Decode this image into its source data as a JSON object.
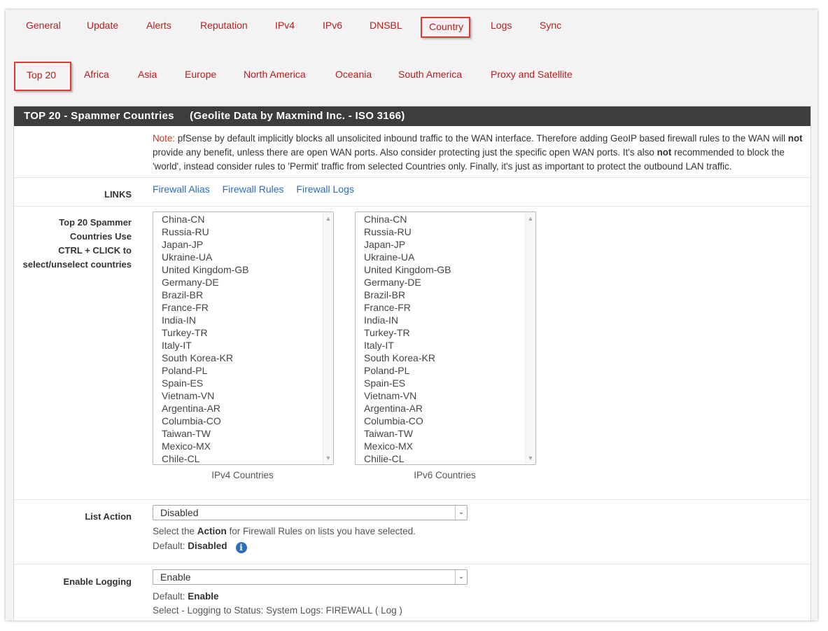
{
  "tabs_top": [
    "General",
    "Update",
    "Alerts",
    "Reputation",
    "IPv4",
    "IPv6",
    "DNSBL",
    "Country",
    "Logs",
    "Sync"
  ],
  "tabs_top_active": "Country",
  "tabs_country": [
    "Top 20",
    "Africa",
    "Asia",
    "Europe",
    "North America",
    "Oceania",
    "South America",
    "Proxy and Satellite"
  ],
  "tabs_country_active": "Top 20",
  "panel": {
    "title": "TOP 20 - Spammer Countries     (Geolite Data by Maxmind Inc. - ISO 3166)"
  },
  "note": {
    "prefix": "Note:",
    "t1": " pfSense by default implicitly blocks all unsolicited inbound traffic to the WAN interface. Therefore adding GeoIP based firewall rules to the WAN will ",
    "b1": "not",
    "t2": " provide any benefit, unless there are open WAN ports. Also consider protecting just the specific open WAN ports. It's also ",
    "b2": "not",
    "t3": " recommended to block the 'world', instead consider rules to 'Permit' traffic from selected Countries only. Finally, it's just as important to protect the outbound LAN traffic."
  },
  "links": {
    "label": "LINKS",
    "items": [
      "Firewall Alias",
      "Firewall Rules",
      "Firewall Logs"
    ]
  },
  "countries": {
    "label_lines": [
      "Top 20 Spammer",
      "Countries Use",
      "CTRL + CLICK to",
      "select/unselect countries"
    ],
    "ipv4": [
      "China-CN",
      "Russia-RU",
      "Japan-JP",
      "Ukraine-UA",
      "United Kingdom-GB",
      "Germany-DE",
      "Brazil-BR",
      "France-FR",
      "India-IN",
      "Turkey-TR",
      "Italy-IT",
      "South Korea-KR",
      "Poland-PL",
      "Spain-ES",
      "Vietnam-VN",
      "Argentina-AR",
      "Columbia-CO",
      "Taiwan-TW",
      "Mexico-MX",
      "Chile-CL"
    ],
    "ipv6": [
      "China-CN",
      "Russia-RU",
      "Japan-JP",
      "Ukraine-UA",
      "United Kingdom-GB",
      "Germany-DE",
      "Brazil-BR",
      "France-FR",
      "India-IN",
      "Turkey-TR",
      "Italy-IT",
      "South Korea-KR",
      "Poland-PL",
      "Spain-ES",
      "Vietnam-VN",
      "Argentina-AR",
      "Columbia-CO",
      "Taiwan-TW",
      "Mexico-MX",
      "Chilie-CL"
    ],
    "ipv4_caption": "IPv4 Countries",
    "ipv6_caption": "IPv6 Countries"
  },
  "list_action": {
    "label": "List Action",
    "value": "Disabled",
    "help_pre": "Select the ",
    "help_bold": "Action",
    "help_post": " for Firewall Rules on lists you have selected.",
    "default_label": "Default: ",
    "default_value": "Disabled",
    "info_icon": "info-icon"
  },
  "logging": {
    "label": "Enable Logging",
    "value": "Enable",
    "default_label": "Default: ",
    "default_value": "Enable",
    "help": "Select - Logging to Status: System Logs: FIREWALL ( Log )"
  },
  "colors": {
    "tab_text": "#b3201f",
    "active_border": "#d93a3a",
    "header_bg": "#3d3d3d",
    "link": "#2a6ebf"
  }
}
